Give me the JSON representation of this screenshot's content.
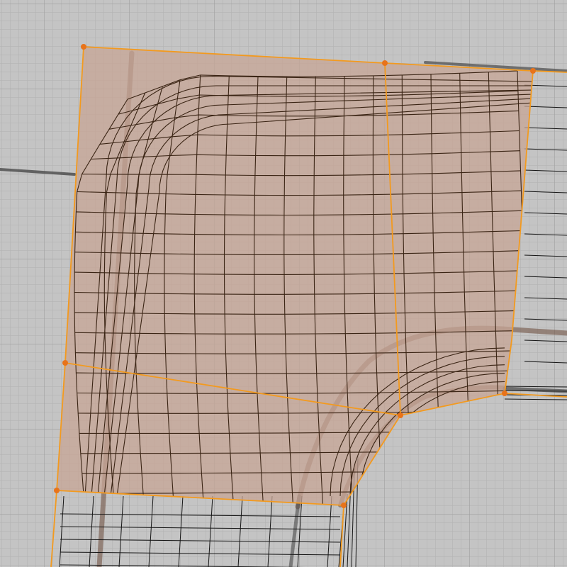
{
  "viewport": {
    "mode": "edit-mode",
    "view": "top-orthographic",
    "background_color": "#c4c4c4",
    "grid_minor_color": "#b1b1b1",
    "grid_major_color": "#9a9a9a"
  },
  "mesh": {
    "cage_face_fill": "#c7a596",
    "cage_edge_color": "#f39a1e",
    "selected_vertex_color": "#e8731a",
    "wire_color": "#3a2414",
    "unselected_wire_color": "#151515",
    "ghost_edge_color": "#4a4a4a"
  }
}
